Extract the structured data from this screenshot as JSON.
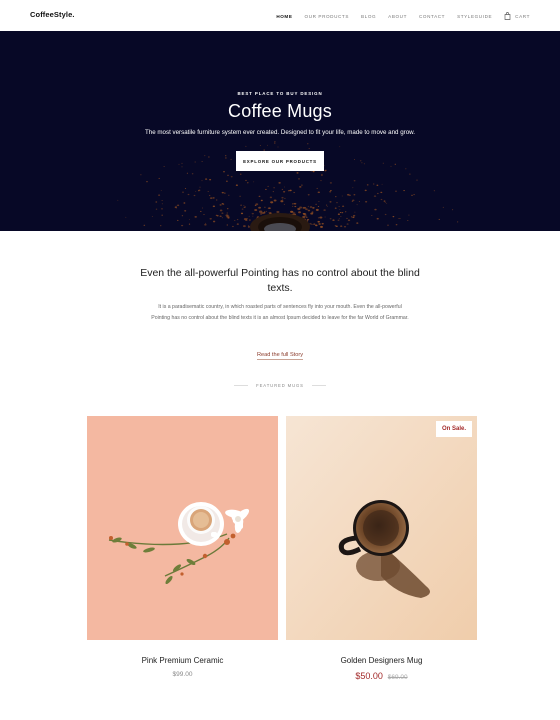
{
  "brand": "CoffeeStyle.",
  "nav": {
    "items": [
      "HOME",
      "OUR PRODUCTS",
      "BLOG",
      "ABOUT",
      "CONTACT",
      "STYLEGUIDE"
    ],
    "cart": "CART"
  },
  "hero": {
    "subtitle": "BEST PLACE TO BUY DESIGN",
    "title": "Coffee Mugs",
    "description": "The most versatile furniture system ever created. Designed to fit your life, made to move and grow.",
    "button": "EXPLORE OUR PRODUCTS"
  },
  "intro": {
    "title": "Even the all-powerful Pointing has no control about the blind texts.",
    "text": "It is a paradisematic country, in which roasted parts of sentences fly into your mouth. Even the all-powerful Pointing has no control about the blind texts it is an almost Ipsum decided to leave for the far World of Grammar.",
    "link": "Read the full Story"
  },
  "featured_label": "FEATURED MUGS",
  "products": [
    {
      "name": "Pink Premium Ceramic",
      "price": "$99.00"
    },
    {
      "name": "Golden Designers Mug",
      "price": "$50.00",
      "old_price": "$69.00",
      "badge": "On Sale."
    }
  ],
  "colors": {
    "hero_bg": "#070826",
    "accent": "#a32a2a",
    "card_pink": "#f4b8a1",
    "card_beige": "#f4dcc3"
  }
}
